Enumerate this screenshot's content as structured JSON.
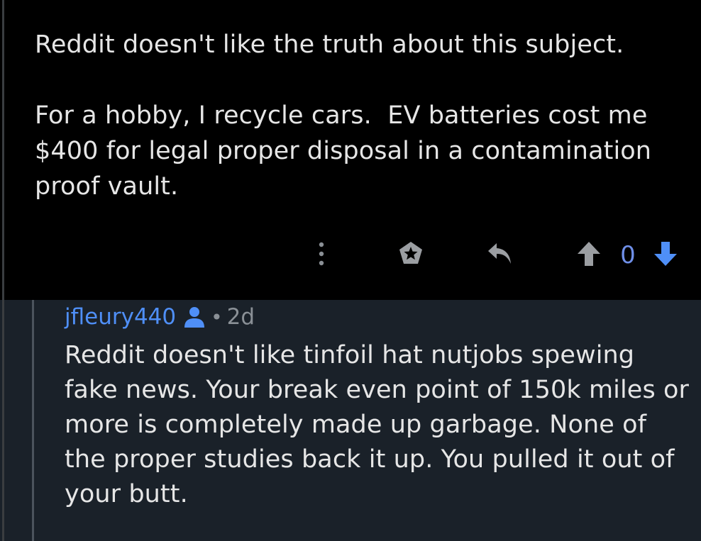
{
  "parent_comment": {
    "paragraphs": [
      "Reddit doesn't like the truth about this subject.",
      "For a hobby, I recycle cars.  EV batteries cost me $400 for legal proper disposal in a contamination proof vault."
    ]
  },
  "actions": {
    "more_icon": "more-vertical-icon",
    "award_icon": "award-star-icon",
    "reply_icon": "reply-arrow-icon",
    "upvote_icon": "upvote-arrow-icon",
    "score": "0",
    "downvote_icon": "downvote-arrow-icon",
    "score_color": "#6f8fe8",
    "downvote_color": "#4f8ff7"
  },
  "reply_comment": {
    "username": "jfleury440",
    "user_badge_icon": "user-icon",
    "separator": "•",
    "age": "2d",
    "body": "Reddit doesn't like tinfoil hat nutjobs spewing fake news. Your break even point of 150k miles or more is completely made up garbage. None of the proper studies back it up. You pulled it out of your butt."
  },
  "colors": {
    "background_top": "#000000",
    "background_reply": "#1a2129",
    "text": "#e6e6e6",
    "username": "#4f8ff7",
    "muted": "#8a9096"
  }
}
